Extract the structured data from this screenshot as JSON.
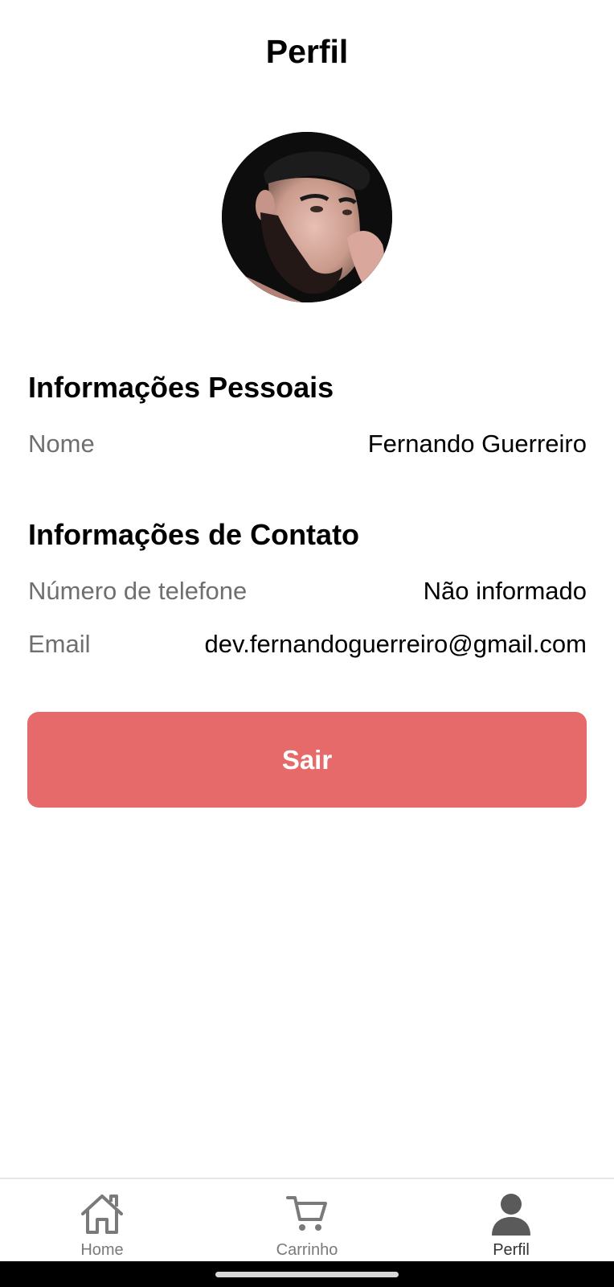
{
  "header": {
    "title": "Perfil"
  },
  "profile": {
    "avatar_alt": "Foto de perfil"
  },
  "personal": {
    "title": "Informações Pessoais",
    "name_label": "Nome",
    "name_value": "Fernando Guerreiro"
  },
  "contact": {
    "title": "Informações de Contato",
    "phone_label": "Número de telefone",
    "phone_value": "Não informado",
    "email_label": "Email",
    "email_value": "dev.fernandoguerreiro@gmail.com"
  },
  "actions": {
    "logout_label": "Sair",
    "logout_color": "#e76a6b"
  },
  "tabbar": {
    "items": [
      {
        "label": "Home",
        "icon": "home-icon",
        "active": false
      },
      {
        "label": "Carrinho",
        "icon": "cart-icon",
        "active": false
      },
      {
        "label": "Perfil",
        "icon": "user-icon",
        "active": true
      }
    ]
  }
}
